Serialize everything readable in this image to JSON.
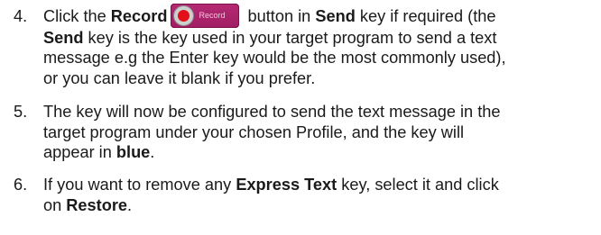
{
  "items": [
    {
      "number": "4.",
      "l1_pre": "Click the ",
      "l1_bold1": "Record",
      "record_button_label": "Record",
      "l1_post1": " button in ",
      "l1_bold2": "Send",
      "l1_post2": " key if required (the",
      "l2_bold": "Send",
      "l2_post": " key is the key used in your target program to send a text",
      "l3": "message e.g the Enter key would be the most commonly used),",
      "l4": "or you can leave it blank if you prefer."
    },
    {
      "number": "5.",
      "l1": "The key will now be configured to send the text message in the",
      "l2": "target program under your chosen Profile, and the key will",
      "l3_pre": "appear in ",
      "l3_bold": "blue",
      "l3_post": "."
    },
    {
      "number": "6.",
      "l1_pre": "If you want to remove any ",
      "l1_bold": "Express Text",
      "l1_post": " key, select it and click",
      "l2_pre": "on ",
      "l2_bold": "Restore",
      "l2_post": "."
    }
  ],
  "colors": {
    "text": "#1a1a1a",
    "record_button_bg": "#a11e63",
    "record_dot": "#e3101a"
  },
  "icons": {
    "record_button": "record-circle-icon"
  }
}
